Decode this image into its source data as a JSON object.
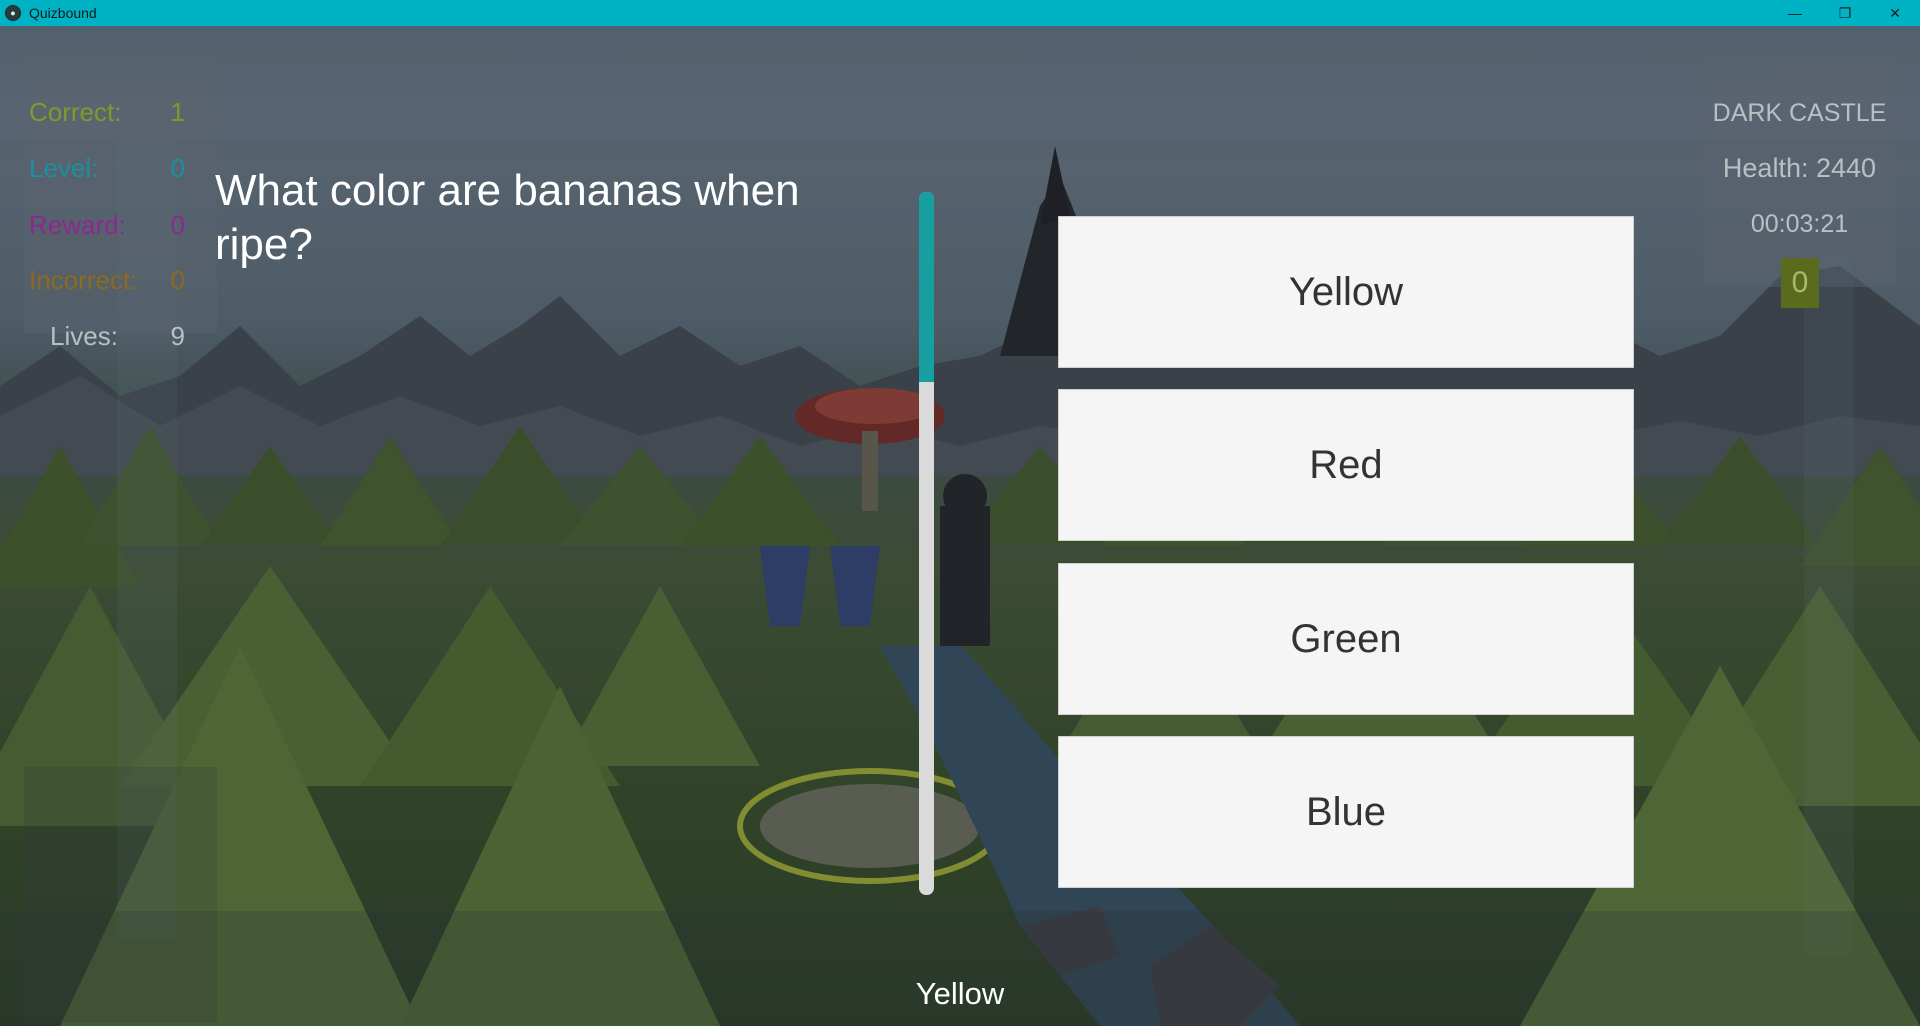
{
  "window": {
    "title": "Quizbound",
    "minimize_glyph": "—",
    "restore_glyph": "❐",
    "close_glyph": "✕"
  },
  "stats": {
    "correct": {
      "label": "Correct:",
      "value": "1"
    },
    "level": {
      "label": "Level:",
      "value": "0"
    },
    "reward": {
      "label": "Reward:",
      "value": "0"
    },
    "incorrect": {
      "label": "Incorrect:",
      "value": "0"
    },
    "lives": {
      "label": "Lives:",
      "value": "9"
    }
  },
  "enemy": {
    "zone": "DARK CASTLE",
    "health_label": "Health:",
    "health_value": "2440",
    "timer": "00:03:21",
    "score": "0"
  },
  "quiz": {
    "question": "What color are bananas when ripe?",
    "answers": [
      "Yellow",
      "Red",
      "Green",
      "Blue"
    ],
    "selected": "Yellow"
  },
  "colors": {
    "titlebar": "#00b3c4",
    "correct": "#7d9b2a",
    "level": "#1c8fa0",
    "reward": "#8a2a8f",
    "incorrect": "#8c6a1e",
    "scroll_thumb": "#179ea1"
  },
  "icons": {
    "app": "game-controller-icon"
  }
}
